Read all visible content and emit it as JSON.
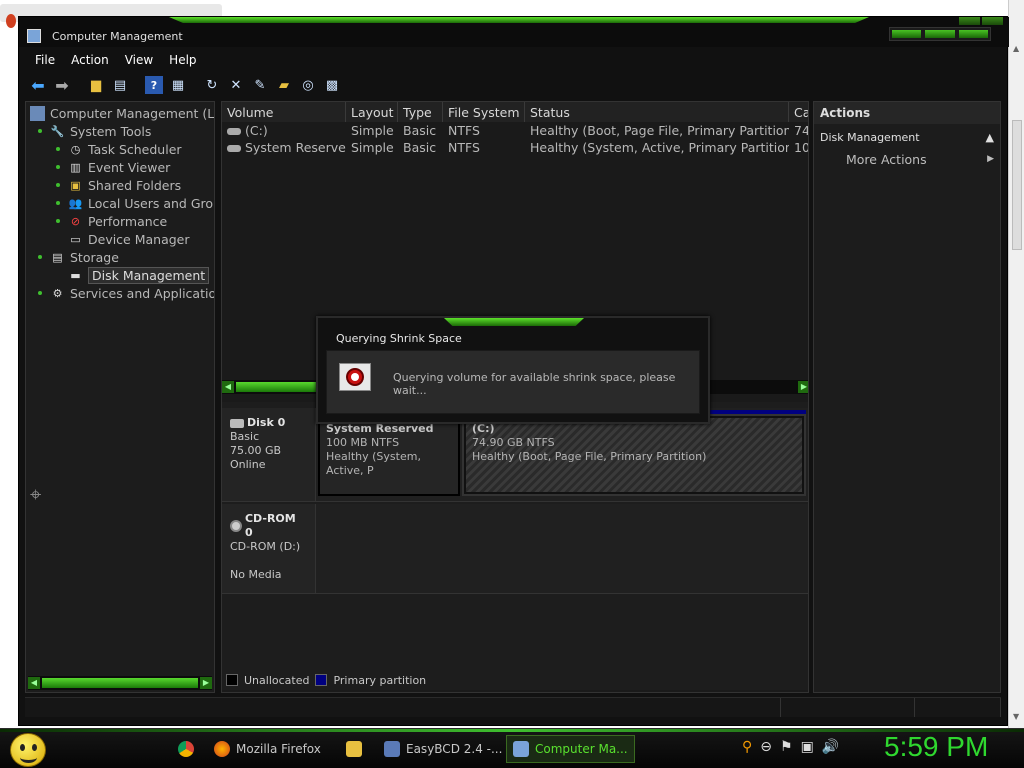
{
  "window": {
    "title": "Computer Management"
  },
  "menu": [
    "File",
    "Action",
    "View",
    "Help"
  ],
  "toolbar_icons": [
    "back-arrow-icon",
    "forward-arrow-icon",
    "up-folder-icon",
    "show-hide-tree-icon",
    "help-icon",
    "properties-icon",
    "refresh-icon",
    "delete-icon",
    "export-icon",
    "open-icon",
    "search-icon",
    "settings-icon"
  ],
  "tree": {
    "root": "Computer Management (Loc",
    "items": [
      {
        "label": "System Tools",
        "level": 1
      },
      {
        "label": "Task Scheduler",
        "level": 2
      },
      {
        "label": "Event Viewer",
        "level": 2
      },
      {
        "label": "Shared Folders",
        "level": 2
      },
      {
        "label": "Local Users and Grou",
        "level": 2
      },
      {
        "label": "Performance",
        "level": 2
      },
      {
        "label": "Device Manager",
        "level": 2
      },
      {
        "label": "Storage",
        "level": 1
      },
      {
        "label": "Disk Management",
        "level": 2,
        "selected": true
      },
      {
        "label": "Services and Applications",
        "level": 1
      }
    ]
  },
  "volume_list": {
    "columns": [
      "Volume",
      "Layout",
      "Type",
      "File System",
      "Status",
      "Ca"
    ],
    "rows": [
      {
        "volume": "(C:)",
        "layout": "Simple",
        "type": "Basic",
        "fs": "NTFS",
        "status": "Healthy (Boot, Page File, Primary Partition)",
        "cap": "74"
      },
      {
        "volume": "System Reserved",
        "layout": "Simple",
        "type": "Basic",
        "fs": "NTFS",
        "status": "Healthy (System, Active, Primary Partition)",
        "cap": "10"
      }
    ]
  },
  "disks": {
    "disk0": {
      "name": "Disk 0",
      "type": "Basic",
      "size": "75.00 GB",
      "state": "Online",
      "partitions": [
        {
          "name": "System Reserved",
          "size": "100 MB NTFS",
          "status": "Healthy (System, Active, P"
        },
        {
          "name": "(C:)",
          "size": "74.90 GB NTFS",
          "status": "Healthy (Boot, Page File, Primary Partition)"
        }
      ]
    },
    "cdrom0": {
      "name": "CD-ROM 0",
      "drive": "CD-ROM (D:)",
      "state": "No Media"
    }
  },
  "legend": {
    "unallocated": "Unallocated",
    "primary": "Primary partition",
    "unallocated_color": "#000000",
    "primary_color": "#000080"
  },
  "actions": {
    "header": "Actions",
    "group": "Disk Management",
    "more": "More Actions"
  },
  "dialog": {
    "title": "Querying Shrink Space",
    "message": "Querying volume for available shrink space, please wait..."
  },
  "taskbar": {
    "items": [
      {
        "label": "Mozilla Firefox"
      },
      {
        "label": "EasyBCD 2.4 -..."
      },
      {
        "label": "Computer Ma...",
        "active": true
      }
    ],
    "clock": "5:59 PM"
  },
  "colors": {
    "accent": "#3fbf2f",
    "background": "#111111"
  }
}
